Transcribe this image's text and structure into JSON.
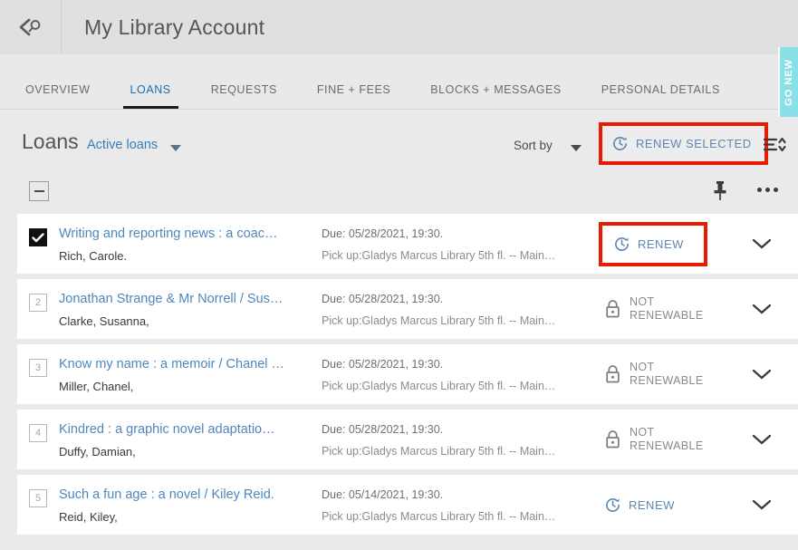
{
  "header": {
    "back_icon": "back-search-icon",
    "title": "My Library Account"
  },
  "tabs": [
    {
      "label": "OVERVIEW",
      "active": false
    },
    {
      "label": "LOANS",
      "active": true
    },
    {
      "label": "REQUESTS",
      "active": false
    },
    {
      "label": "FINE + FEES",
      "active": false
    },
    {
      "label": "BLOCKS + MESSAGES",
      "active": false
    },
    {
      "label": "PERSONAL DETAILS",
      "active": false
    }
  ],
  "feedback_tab": {
    "label": "GO NEW",
    "color": "#89e0e6"
  },
  "toolbar": {
    "section_title": "Loans",
    "filter_label": "Active loans",
    "sort_by_label": "Sort by",
    "renew_selected_label": "RENEW SELECTED",
    "sort_toggle_icon": "sort-lines-icon",
    "select_all_icon": "indeterminate-checkbox-icon",
    "pin_icon": "pin-icon",
    "more_icon": "more-horizontal-icon",
    "highlight_color": "#e81c00",
    "link_color": "#3a7cb8",
    "action_color": "#5d87b0"
  },
  "loans": [
    {
      "index": "1",
      "selected": true,
      "title": "Writing and reporting news : a coac…",
      "author": "Rich, Carole.",
      "due": "Due: 05/28/2021, 19:30.",
      "pickup": "Pick up:Gladys Marcus Library 5th fl. -- Main…",
      "action": "RENEW",
      "action_type": "renew",
      "highlighted": true
    },
    {
      "index": "2",
      "selected": false,
      "title": "Jonathan Strange & Mr Norrell / Sus…",
      "author": "Clarke, Susanna,",
      "due": "Due: 05/28/2021, 19:30.",
      "pickup": "Pick up:Gladys Marcus Library 5th fl. -- Main…",
      "action": "NOT RENEWABLE",
      "action_type": "locked",
      "highlighted": false
    },
    {
      "index": "3",
      "selected": false,
      "title": "Know my name : a memoir / Chanel …",
      "author": "Miller, Chanel,",
      "due": "Due: 05/28/2021, 19:30.",
      "pickup": "Pick up:Gladys Marcus Library 5th fl. -- Main…",
      "action": "NOT RENEWABLE",
      "action_type": "locked",
      "highlighted": false
    },
    {
      "index": "4",
      "selected": false,
      "title": "Kindred : a graphic novel adaptatio…",
      "author": "Duffy, Damian,",
      "due": "Due: 05/28/2021, 19:30.",
      "pickup": "Pick up:Gladys Marcus Library 5th fl. -- Main…",
      "action": "NOT RENEWABLE",
      "action_type": "locked",
      "highlighted": false
    },
    {
      "index": "5",
      "selected": false,
      "title": "Such a fun age : a novel / Kiley Reid.",
      "author": "Reid, Kiley,",
      "due": "Due: 05/14/2021, 19:30.",
      "pickup": "Pick up:Gladys Marcus Library 5th fl. -- Main…",
      "action": "RENEW",
      "action_type": "renew",
      "highlighted": false
    }
  ]
}
